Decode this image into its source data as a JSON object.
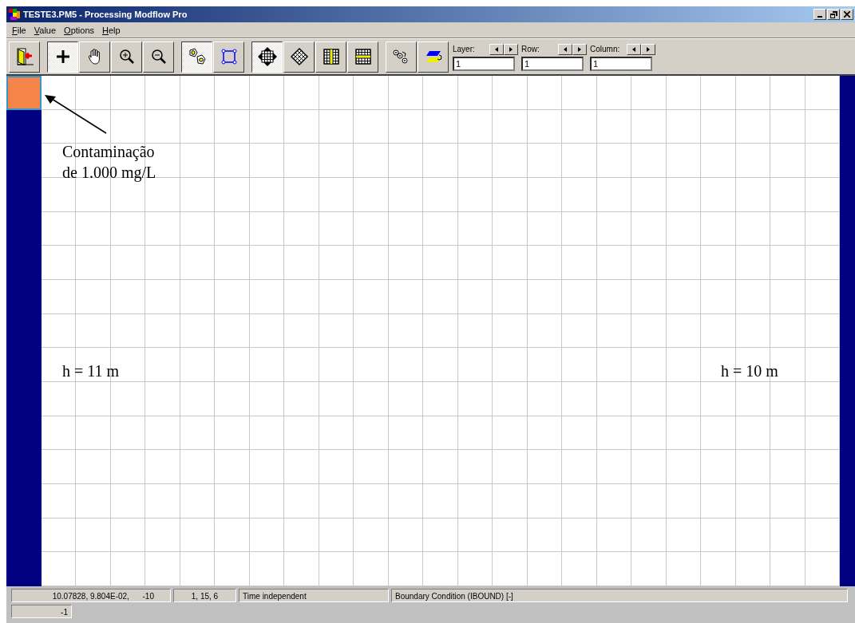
{
  "window": {
    "title": "TESTE3.PM5 - Processing Modflow Pro"
  },
  "menu": [
    "File",
    "Value",
    "Options",
    "Help"
  ],
  "toolbar": [
    [
      {
        "kind": "exit",
        "pressed": false
      }
    ],
    [
      {
        "kind": "plus",
        "pressed": true
      },
      {
        "kind": "hand",
        "pressed": false
      },
      {
        "kind": "zoom-in",
        "pressed": false
      },
      {
        "kind": "zoom-out",
        "pressed": false
      }
    ],
    [
      {
        "kind": "cells",
        "pressed": true
      },
      {
        "kind": "polygon",
        "pressed": false
      }
    ],
    [
      {
        "kind": "move-grid",
        "pressed": true
      },
      {
        "kind": "rotate-grid",
        "pressed": false
      },
      {
        "kind": "column",
        "pressed": false
      },
      {
        "kind": "row",
        "pressed": false
      }
    ],
    [
      {
        "kind": "gears",
        "pressed": false
      },
      {
        "kind": "layers",
        "pressed": false
      }
    ]
  ],
  "spinners": [
    {
      "label": "Layer:",
      "value": "1"
    },
    {
      "label": "Row:",
      "value": "1"
    },
    {
      "label": "Column:",
      "value": "1"
    }
  ],
  "grid": {
    "rows": [
      [
        {
          "kind": "source"
        },
        {
          "kind": "active"
        },
        {
          "kind": "active"
        },
        {
          "kind": "active"
        },
        {
          "kind": "active"
        },
        {
          "kind": "active"
        },
        {
          "kind": "active"
        },
        {
          "kind": "active"
        },
        {
          "kind": "active"
        },
        {
          "kind": "active"
        },
        {
          "kind": "active"
        },
        {
          "kind": "active"
        },
        {
          "kind": "active"
        },
        {
          "kind": "active"
        },
        {
          "kind": "active"
        },
        {
          "kind": "active"
        },
        {
          "kind": "active"
        },
        {
          "kind": "active"
        },
        {
          "kind": "active"
        },
        {
          "kind": "active"
        },
        {
          "kind": "active"
        },
        {
          "kind": "active"
        },
        {
          "kind": "active"
        },
        {
          "kind": "active"
        },
        {
          "kind": "fixed"
        }
      ],
      [
        {
          "kind": "fixed"
        },
        {
          "kind": "active"
        },
        {
          "kind": "active"
        },
        {
          "kind": "active"
        },
        {
          "kind": "active"
        },
        {
          "kind": "active"
        },
        {
          "kind": "active"
        },
        {
          "kind": "active"
        },
        {
          "kind": "active"
        },
        {
          "kind": "active"
        },
        {
          "kind": "active"
        },
        {
          "kind": "active"
        },
        {
          "kind": "active"
        },
        {
          "kind": "active"
        },
        {
          "kind": "active"
        },
        {
          "kind": "active"
        },
        {
          "kind": "active"
        },
        {
          "kind": "active"
        },
        {
          "kind": "active"
        },
        {
          "kind": "active"
        },
        {
          "kind": "active"
        },
        {
          "kind": "active"
        },
        {
          "kind": "active"
        },
        {
          "kind": "active"
        },
        {
          "kind": "fixed"
        }
      ],
      [
        {
          "kind": "fixed"
        },
        {
          "kind": "active"
        },
        {
          "kind": "active"
        },
        {
          "kind": "active"
        },
        {
          "kind": "active"
        },
        {
          "kind": "active"
        },
        {
          "kind": "active"
        },
        {
          "kind": "active"
        },
        {
          "kind": "active"
        },
        {
          "kind": "active"
        },
        {
          "kind": "active"
        },
        {
          "kind": "active"
        },
        {
          "kind": "active"
        },
        {
          "kind": "active"
        },
        {
          "kind": "active"
        },
        {
          "kind": "active"
        },
        {
          "kind": "active"
        },
        {
          "kind": "active"
        },
        {
          "kind": "active"
        },
        {
          "kind": "active"
        },
        {
          "kind": "active"
        },
        {
          "kind": "active"
        },
        {
          "kind": "active"
        },
        {
          "kind": "active"
        },
        {
          "kind": "fixed"
        }
      ],
      [
        {
          "kind": "fixed"
        },
        {
          "kind": "active"
        },
        {
          "kind": "active"
        },
        {
          "kind": "active"
        },
        {
          "kind": "active"
        },
        {
          "kind": "active"
        },
        {
          "kind": "active"
        },
        {
          "kind": "active"
        },
        {
          "kind": "active"
        },
        {
          "kind": "active"
        },
        {
          "kind": "active"
        },
        {
          "kind": "active"
        },
        {
          "kind": "active"
        },
        {
          "kind": "active"
        },
        {
          "kind": "active"
        },
        {
          "kind": "active"
        },
        {
          "kind": "active"
        },
        {
          "kind": "active"
        },
        {
          "kind": "active"
        },
        {
          "kind": "active"
        },
        {
          "kind": "active"
        },
        {
          "kind": "active"
        },
        {
          "kind": "active"
        },
        {
          "kind": "active"
        },
        {
          "kind": "fixed"
        }
      ],
      [
        {
          "kind": "fixed"
        },
        {
          "kind": "active"
        },
        {
          "kind": "active"
        },
        {
          "kind": "active"
        },
        {
          "kind": "active"
        },
        {
          "kind": "active"
        },
        {
          "kind": "active"
        },
        {
          "kind": "active"
        },
        {
          "kind": "active"
        },
        {
          "kind": "active"
        },
        {
          "kind": "active"
        },
        {
          "kind": "active"
        },
        {
          "kind": "active"
        },
        {
          "kind": "active"
        },
        {
          "kind": "active"
        },
        {
          "kind": "active"
        },
        {
          "kind": "active"
        },
        {
          "kind": "active"
        },
        {
          "kind": "active"
        },
        {
          "kind": "active"
        },
        {
          "kind": "active"
        },
        {
          "kind": "active"
        },
        {
          "kind": "active"
        },
        {
          "kind": "active"
        },
        {
          "kind": "fixed"
        }
      ],
      [
        {
          "kind": "fixed"
        },
        {
          "kind": "active"
        },
        {
          "kind": "active"
        },
        {
          "kind": "active"
        },
        {
          "kind": "active"
        },
        {
          "kind": "active"
        },
        {
          "kind": "active"
        },
        {
          "kind": "active"
        },
        {
          "kind": "active"
        },
        {
          "kind": "active"
        },
        {
          "kind": "active"
        },
        {
          "kind": "active"
        },
        {
          "kind": "active"
        },
        {
          "kind": "active"
        },
        {
          "kind": "active"
        },
        {
          "kind": "active"
        },
        {
          "kind": "active"
        },
        {
          "kind": "active"
        },
        {
          "kind": "active"
        },
        {
          "kind": "active"
        },
        {
          "kind": "active"
        },
        {
          "kind": "active"
        },
        {
          "kind": "active"
        },
        {
          "kind": "active"
        },
        {
          "kind": "fixed"
        }
      ],
      [
        {
          "kind": "fixed"
        },
        {
          "kind": "active"
        },
        {
          "kind": "active"
        },
        {
          "kind": "active"
        },
        {
          "kind": "active"
        },
        {
          "kind": "active"
        },
        {
          "kind": "active"
        },
        {
          "kind": "active"
        },
        {
          "kind": "active"
        },
        {
          "kind": "active"
        },
        {
          "kind": "active"
        },
        {
          "kind": "active"
        },
        {
          "kind": "active"
        },
        {
          "kind": "active"
        },
        {
          "kind": "active"
        },
        {
          "kind": "active"
        },
        {
          "kind": "active"
        },
        {
          "kind": "active"
        },
        {
          "kind": "active"
        },
        {
          "kind": "active"
        },
        {
          "kind": "active"
        },
        {
          "kind": "active"
        },
        {
          "kind": "active"
        },
        {
          "kind": "active"
        },
        {
          "kind": "fixed"
        }
      ],
      [
        {
          "kind": "fixed"
        },
        {
          "kind": "active"
        },
        {
          "kind": "active"
        },
        {
          "kind": "active"
        },
        {
          "kind": "active"
        },
        {
          "kind": "active"
        },
        {
          "kind": "active"
        },
        {
          "kind": "active"
        },
        {
          "kind": "active"
        },
        {
          "kind": "active"
        },
        {
          "kind": "active"
        },
        {
          "kind": "active"
        },
        {
          "kind": "active"
        },
        {
          "kind": "active"
        },
        {
          "kind": "active"
        },
        {
          "kind": "active"
        },
        {
          "kind": "active"
        },
        {
          "kind": "active"
        },
        {
          "kind": "active"
        },
        {
          "kind": "active"
        },
        {
          "kind": "active"
        },
        {
          "kind": "active"
        },
        {
          "kind": "active"
        },
        {
          "kind": "active"
        },
        {
          "kind": "fixed"
        }
      ],
      [
        {
          "kind": "fixed"
        },
        {
          "kind": "active"
        },
        {
          "kind": "active"
        },
        {
          "kind": "active"
        },
        {
          "kind": "active"
        },
        {
          "kind": "active"
        },
        {
          "kind": "active"
        },
        {
          "kind": "active"
        },
        {
          "kind": "active"
        },
        {
          "kind": "active"
        },
        {
          "kind": "active"
        },
        {
          "kind": "active"
        },
        {
          "kind": "active"
        },
        {
          "kind": "active"
        },
        {
          "kind": "active"
        },
        {
          "kind": "active"
        },
        {
          "kind": "active"
        },
        {
          "kind": "active"
        },
        {
          "kind": "active"
        },
        {
          "kind": "active"
        },
        {
          "kind": "active"
        },
        {
          "kind": "active"
        },
        {
          "kind": "active"
        },
        {
          "kind": "active"
        },
        {
          "kind": "fixed"
        }
      ],
      [
        {
          "kind": "fixed"
        },
        {
          "kind": "active"
        },
        {
          "kind": "active"
        },
        {
          "kind": "active"
        },
        {
          "kind": "active"
        },
        {
          "kind": "active"
        },
        {
          "kind": "active"
        },
        {
          "kind": "active"
        },
        {
          "kind": "active"
        },
        {
          "kind": "active"
        },
        {
          "kind": "active"
        },
        {
          "kind": "active"
        },
        {
          "kind": "active"
        },
        {
          "kind": "active"
        },
        {
          "kind": "active"
        },
        {
          "kind": "active"
        },
        {
          "kind": "active"
        },
        {
          "kind": "active"
        },
        {
          "kind": "active"
        },
        {
          "kind": "active"
        },
        {
          "kind": "active"
        },
        {
          "kind": "active"
        },
        {
          "kind": "active"
        },
        {
          "kind": "active"
        },
        {
          "kind": "fixed"
        }
      ],
      [
        {
          "kind": "fixed"
        },
        {
          "kind": "active"
        },
        {
          "kind": "active"
        },
        {
          "kind": "active"
        },
        {
          "kind": "active"
        },
        {
          "kind": "active"
        },
        {
          "kind": "active"
        },
        {
          "kind": "active"
        },
        {
          "kind": "active"
        },
        {
          "kind": "active"
        },
        {
          "kind": "active"
        },
        {
          "kind": "active"
        },
        {
          "kind": "active"
        },
        {
          "kind": "active"
        },
        {
          "kind": "active"
        },
        {
          "kind": "active"
        },
        {
          "kind": "active"
        },
        {
          "kind": "active"
        },
        {
          "kind": "active"
        },
        {
          "kind": "active"
        },
        {
          "kind": "active"
        },
        {
          "kind": "active"
        },
        {
          "kind": "active"
        },
        {
          "kind": "active"
        },
        {
          "kind": "fixed"
        }
      ],
      [
        {
          "kind": "fixed"
        },
        {
          "kind": "active"
        },
        {
          "kind": "active"
        },
        {
          "kind": "active"
        },
        {
          "kind": "active"
        },
        {
          "kind": "active"
        },
        {
          "kind": "active"
        },
        {
          "kind": "active"
        },
        {
          "kind": "active"
        },
        {
          "kind": "active"
        },
        {
          "kind": "active"
        },
        {
          "kind": "active"
        },
        {
          "kind": "active"
        },
        {
          "kind": "active"
        },
        {
          "kind": "active"
        },
        {
          "kind": "active"
        },
        {
          "kind": "active"
        },
        {
          "kind": "active"
        },
        {
          "kind": "active"
        },
        {
          "kind": "active"
        },
        {
          "kind": "active"
        },
        {
          "kind": "active"
        },
        {
          "kind": "active"
        },
        {
          "kind": "active"
        },
        {
          "kind": "fixed"
        }
      ],
      [
        {
          "kind": "fixed"
        },
        {
          "kind": "active"
        },
        {
          "kind": "active"
        },
        {
          "kind": "active"
        },
        {
          "kind": "active"
        },
        {
          "kind": "active"
        },
        {
          "kind": "active"
        },
        {
          "kind": "active"
        },
        {
          "kind": "active"
        },
        {
          "kind": "active"
        },
        {
          "kind": "active"
        },
        {
          "kind": "active"
        },
        {
          "kind": "active"
        },
        {
          "kind": "active"
        },
        {
          "kind": "active"
        },
        {
          "kind": "active"
        },
        {
          "kind": "active"
        },
        {
          "kind": "active"
        },
        {
          "kind": "active"
        },
        {
          "kind": "active"
        },
        {
          "kind": "active"
        },
        {
          "kind": "active"
        },
        {
          "kind": "active"
        },
        {
          "kind": "active"
        },
        {
          "kind": "fixed"
        }
      ],
      [
        {
          "kind": "fixed"
        },
        {
          "kind": "active"
        },
        {
          "kind": "active"
        },
        {
          "kind": "active"
        },
        {
          "kind": "active"
        },
        {
          "kind": "active"
        },
        {
          "kind": "active"
        },
        {
          "kind": "active"
        },
        {
          "kind": "active"
        },
        {
          "kind": "active"
        },
        {
          "kind": "active"
        },
        {
          "kind": "active"
        },
        {
          "kind": "active"
        },
        {
          "kind": "active"
        },
        {
          "kind": "active"
        },
        {
          "kind": "active"
        },
        {
          "kind": "active"
        },
        {
          "kind": "active"
        },
        {
          "kind": "active"
        },
        {
          "kind": "active"
        },
        {
          "kind": "active"
        },
        {
          "kind": "active"
        },
        {
          "kind": "active"
        },
        {
          "kind": "active"
        },
        {
          "kind": "fixed"
        }
      ],
      [
        {
          "kind": "fixed"
        },
        {
          "kind": "active"
        },
        {
          "kind": "active"
        },
        {
          "kind": "active"
        },
        {
          "kind": "active"
        },
        {
          "kind": "active"
        },
        {
          "kind": "active"
        },
        {
          "kind": "active"
        },
        {
          "kind": "active"
        },
        {
          "kind": "active"
        },
        {
          "kind": "active"
        },
        {
          "kind": "active"
        },
        {
          "kind": "active"
        },
        {
          "kind": "active"
        },
        {
          "kind": "active"
        },
        {
          "kind": "active"
        },
        {
          "kind": "active"
        },
        {
          "kind": "active"
        },
        {
          "kind": "active"
        },
        {
          "kind": "active"
        },
        {
          "kind": "active"
        },
        {
          "kind": "active"
        },
        {
          "kind": "active"
        },
        {
          "kind": "active"
        },
        {
          "kind": "fixed"
        }
      ]
    ]
  },
  "annotations": [
    {
      "kind": "callout",
      "lines": [
        "Contaminação",
        "de 1.000 mg/L"
      ]
    },
    {
      "kind": "left-head",
      "lines": [
        "h = 11 m"
      ]
    },
    {
      "kind": "right-head",
      "lines": [
        "h = 10 m"
      ]
    }
  ],
  "status_bar": [
    [
      "10.07828, 9.804E-02,      -10",
      "1, 15, 6",
      "Time independent",
      "Boundary Condition (IBOUND) [-]"
    ],
    [
      "-1"
    ]
  ]
}
